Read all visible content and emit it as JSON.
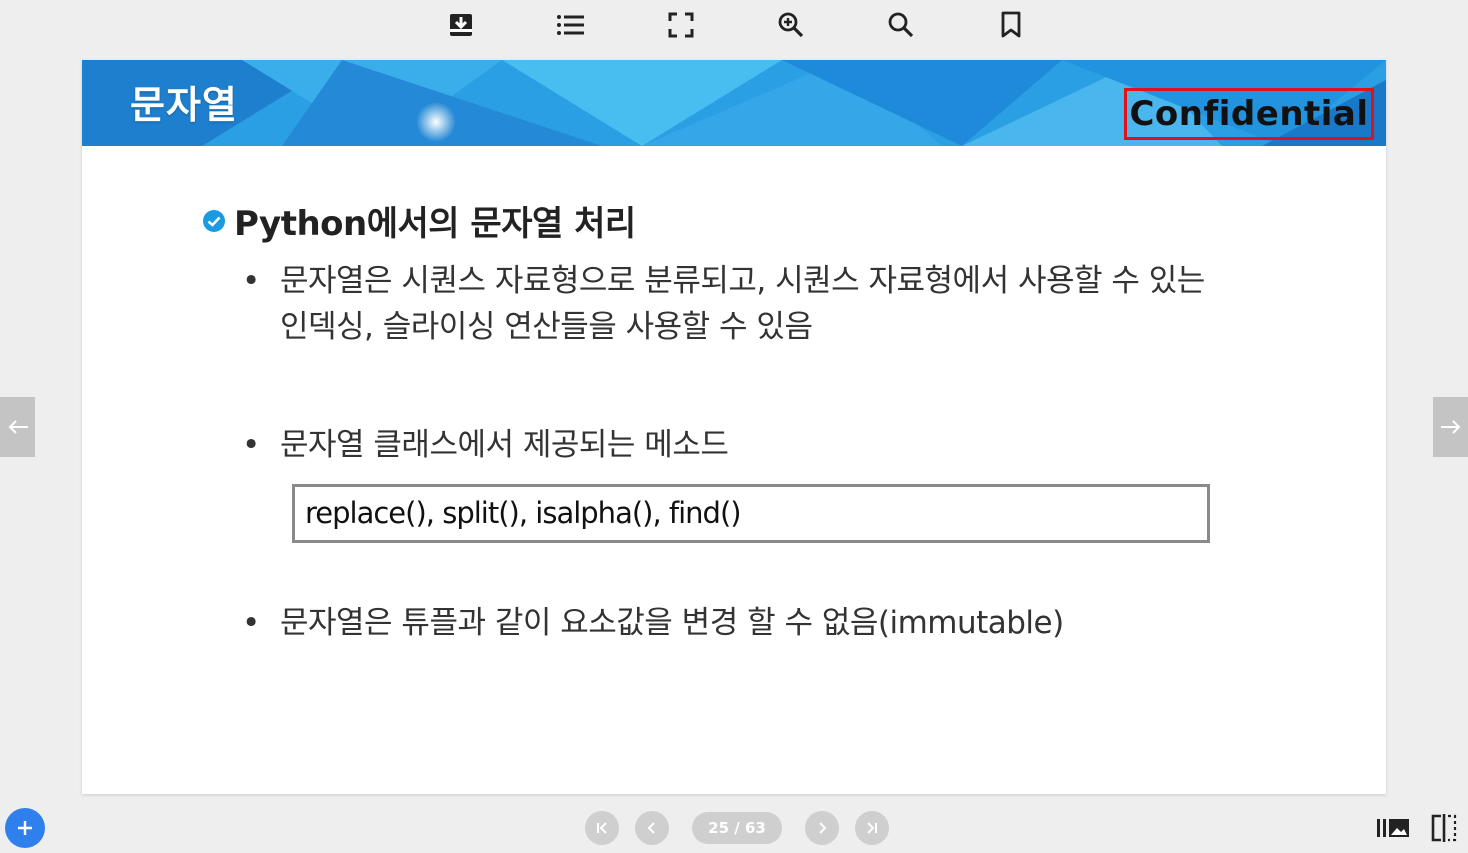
{
  "toolbar": {
    "icons": [
      "download-icon",
      "list-icon",
      "fullscreen-icon",
      "zoom-in-icon",
      "search-icon",
      "bookmark-icon"
    ]
  },
  "slide": {
    "banner_title": "문자열",
    "confidential_label": "Confidential",
    "heading": "Python에서의 문자열 처리",
    "bullets": [
      {
        "line1": "문자열은 시퀀스 자료형으로 분류되고, 시퀀스 자료형에서 사용할 수 있는",
        "line2": "인덱싱, 슬라이싱 연산들을 사용할 수 있음"
      },
      {
        "line1": "문자열 클래스에서 제공되는 메소드"
      },
      {
        "line1": "문자열은 튜플과 같이 요소값을 변경 할 수 없음(immutable)"
      }
    ],
    "bullet_glyph": "•",
    "code_box": "replace(), split(), isalpha(), find()"
  },
  "pagination": {
    "page_label": "25 / 63"
  },
  "colors": {
    "banner": "#2a9fe3",
    "confidential_border": "#e0111a",
    "accent": "#2f80ed"
  }
}
